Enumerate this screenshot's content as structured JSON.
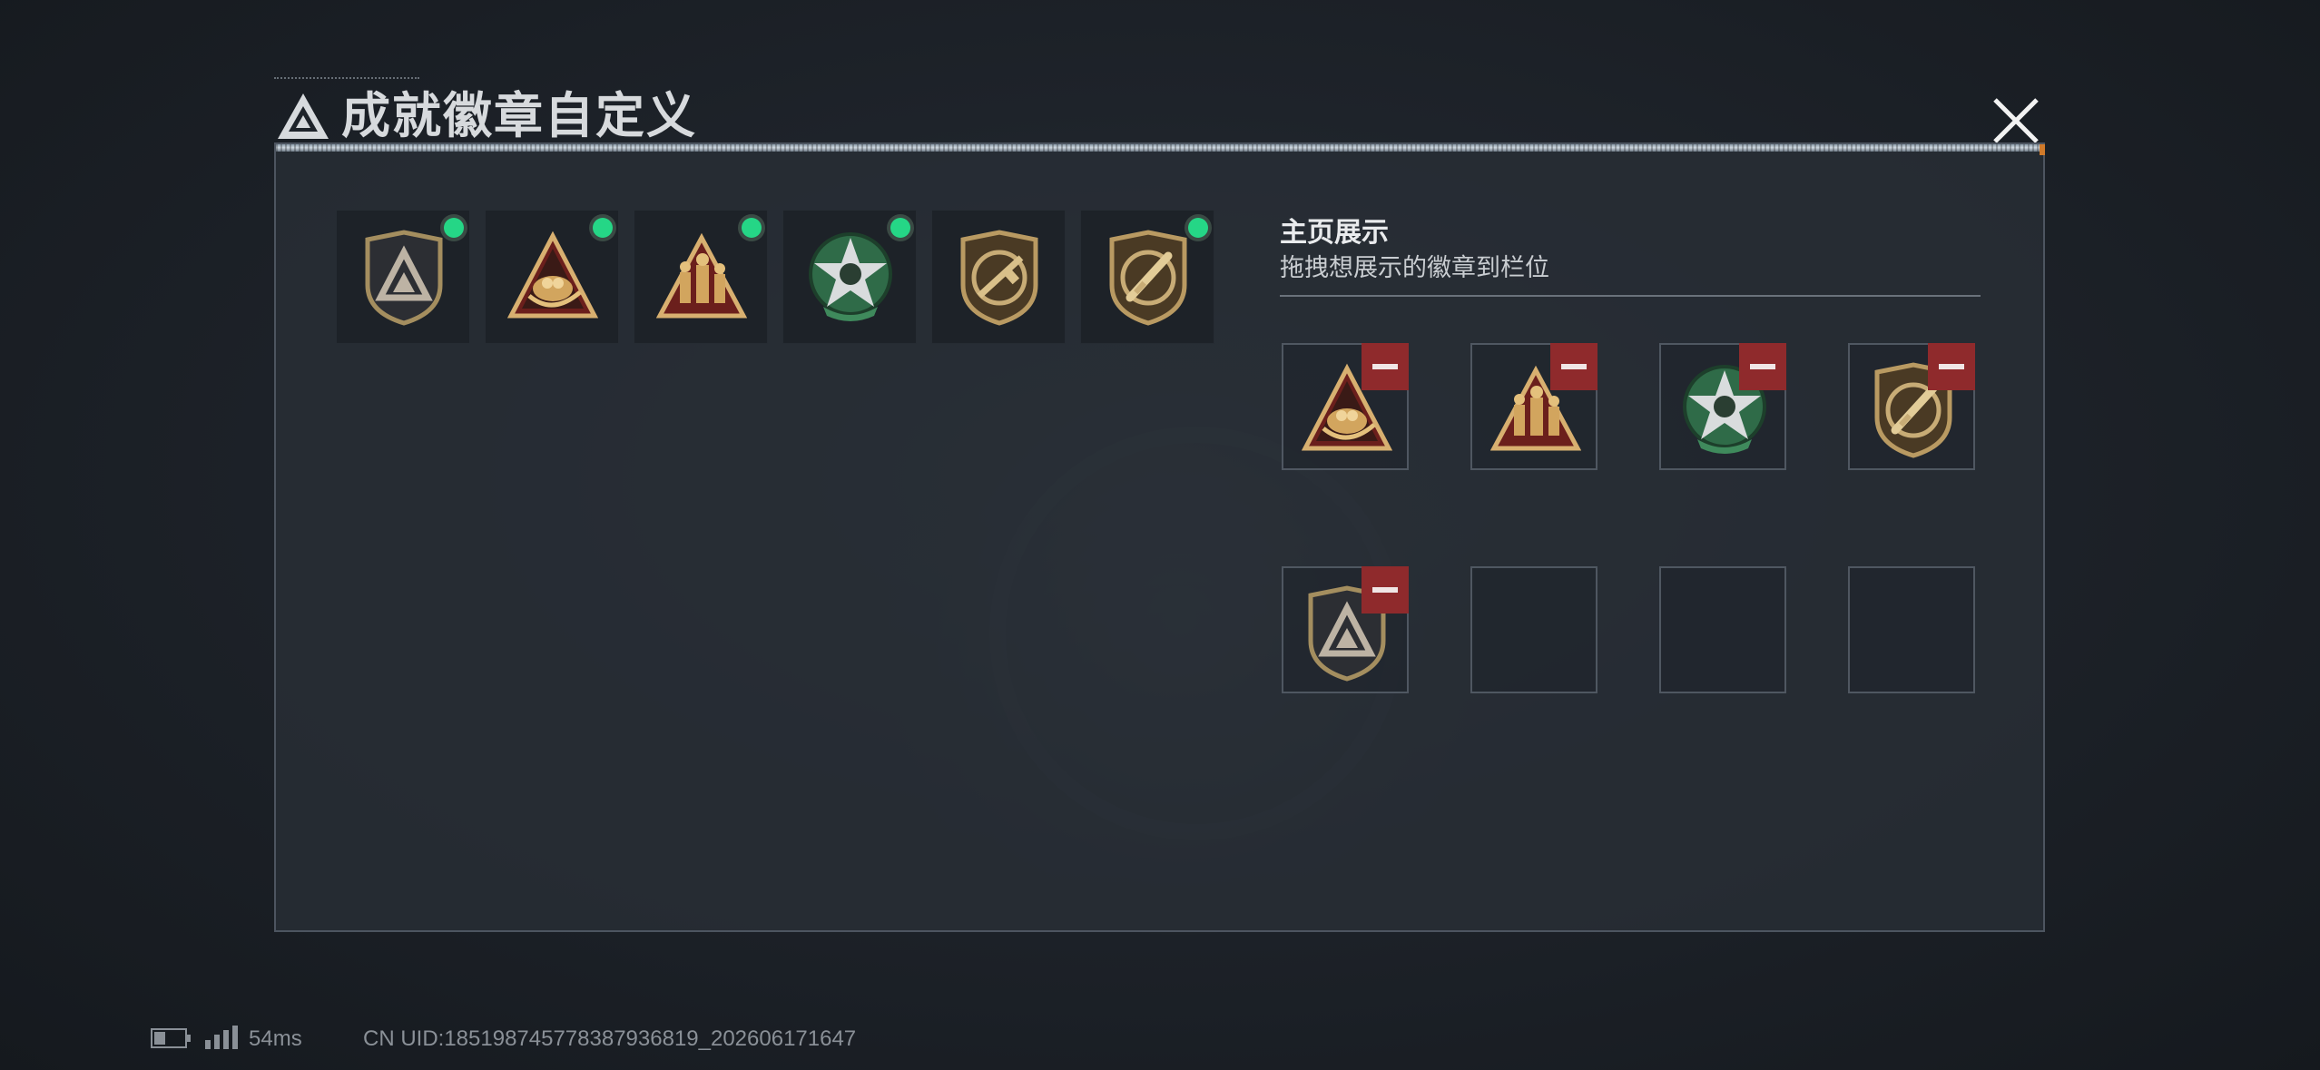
{
  "window": {
    "title": "成就徽章自定义",
    "close_icon": "close-icon"
  },
  "owned_badges": [
    {
      "name": "tri-shield-dark",
      "equipped": true
    },
    {
      "name": "gold-triangle-nest",
      "equipped": true
    },
    {
      "name": "gold-triangle-soldiers",
      "equipped": true
    },
    {
      "name": "green-star-skull",
      "equipped": true
    },
    {
      "name": "shield-rifle",
      "equipped": false
    },
    {
      "name": "shield-knife",
      "equipped": true
    }
  ],
  "showcase": {
    "title": "主页展示",
    "subtitle": "拖拽想展示的徽章到栏位",
    "slots": [
      {
        "badge": "gold-triangle-nest"
      },
      {
        "badge": "gold-triangle-soldiers"
      },
      {
        "badge": "green-star-skull"
      },
      {
        "badge": "shield-knife"
      },
      {
        "badge": "tri-shield-dark"
      },
      {
        "badge": ""
      },
      {
        "badge": ""
      },
      {
        "badge": ""
      }
    ]
  },
  "status_bar": {
    "ping": "54ms",
    "uid": "CN UID:18519874577838793681​9_202606171647"
  },
  "colors": {
    "equipped_dot": "#25d686",
    "remove_button": "#8f2a2c",
    "panel_bg": "#282e36",
    "accent": "#d07a2a"
  }
}
